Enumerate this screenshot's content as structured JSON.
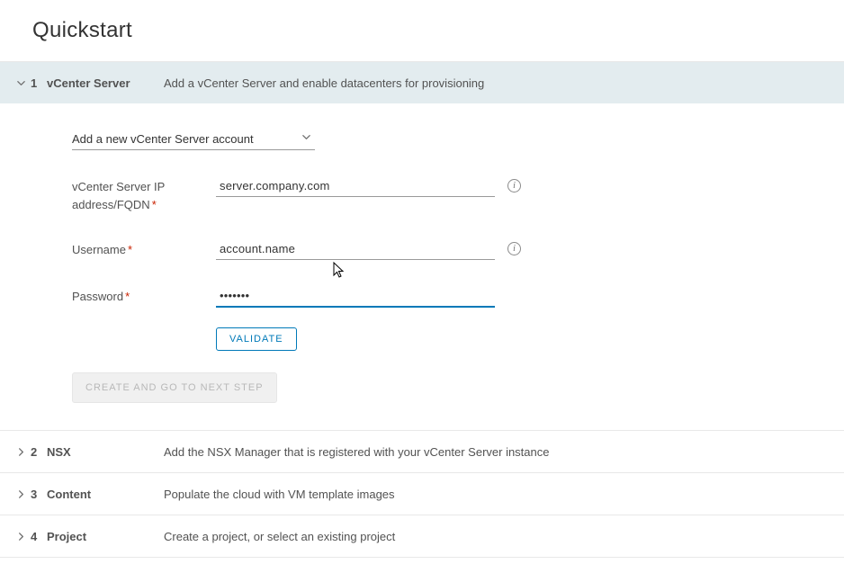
{
  "page_title": "Quickstart",
  "steps": [
    {
      "num": "1",
      "title": "vCenter Server",
      "desc": "Add a vCenter Server and enable datacenters for provisioning",
      "expanded": true
    },
    {
      "num": "2",
      "title": "NSX",
      "desc": "Add the NSX Manager that is registered with your vCenter Server instance",
      "expanded": false
    },
    {
      "num": "3",
      "title": "Content",
      "desc": "Populate the cloud with VM template images",
      "expanded": false
    },
    {
      "num": "4",
      "title": "Project",
      "desc": "Create a project, or select an existing project",
      "expanded": false
    }
  ],
  "form": {
    "account_select": "Add a new vCenter Server account",
    "fields": {
      "address": {
        "label": "vCenter Server IP address/FQDN",
        "value": "server.company.com"
      },
      "username": {
        "label": "Username",
        "value": "account.name"
      },
      "password": {
        "label": "Password",
        "value": "•••••••"
      }
    },
    "validate_btn": "Validate",
    "create_btn": "Create and go to next step"
  }
}
